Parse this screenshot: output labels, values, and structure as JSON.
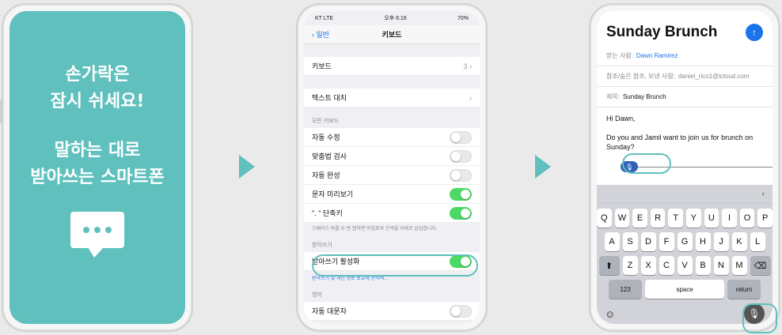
{
  "panel1": {
    "lines": [
      "손가락은",
      "잠시 쉬세요!",
      "말하는 대로",
      "받아쓰는 스마트폰"
    ]
  },
  "panel2": {
    "status": {
      "carrier": "KT LTE",
      "time": "오후 6:16",
      "battery": "70%"
    },
    "nav": {
      "back": "일반",
      "title": "키보드"
    },
    "keyboards": {
      "label": "키보드",
      "value": "3"
    },
    "text_replacement": "텍스트 대치",
    "all_keyboards_header": "모든 키보드",
    "toggles": [
      {
        "label": "자동 수정",
        "on": false
      },
      {
        "label": "맞춤법 검사",
        "on": false
      },
      {
        "label": "자동 완성",
        "on": false
      },
      {
        "label": "문자 미리보기",
        "on": true
      },
      {
        "label": "\". \" 단축키",
        "on": true
      }
    ],
    "shortcut_note": "스페이스 바를 두 번 탭하면 마침표와 간격을 차례로 삽입합니다.",
    "dictation_header": "받아쓰기",
    "dictation": {
      "label": "받아쓰기 활성화",
      "on": true
    },
    "dictation_link": "받아쓰기 및 개인 정보 보호에 관하여...",
    "english_header": "영어",
    "auto_caps": {
      "label": "자동 대문자",
      "on": false
    }
  },
  "panel3": {
    "title": "Sunday Brunch",
    "to_label": "받는 사람:",
    "to_value": "Dawn Ramirez",
    "cc_label": "참조/숨은 참조, 보낸 사람:",
    "cc_value": "daniel_rico1@icloud.com",
    "subject_label": "제목:",
    "subject_value": "Sunday Brunch",
    "body_greeting": "Hi Dawn,",
    "body_text": "Do you and Jamil want to join us for brunch on Sunday?",
    "keyboard": {
      "row1": [
        "Q",
        "W",
        "E",
        "R",
        "T",
        "Y",
        "U",
        "I",
        "O",
        "P"
      ],
      "row2": [
        "A",
        "S",
        "D",
        "F",
        "G",
        "H",
        "J",
        "K",
        "L"
      ],
      "row3": [
        "Z",
        "X",
        "C",
        "V",
        "B",
        "N",
        "M"
      ],
      "num_label": "123",
      "space_label": "space",
      "return_label": "return"
    }
  },
  "colors": {
    "accent": "#5fc0bd",
    "ios_blue": "#1a73e8",
    "toggle_on": "#4cd964"
  },
  "icons": [
    "chevron-left-icon",
    "chevron-right-icon",
    "send-arrow-icon",
    "mic-icon",
    "emoji-icon",
    "shift-icon",
    "backspace-icon"
  ]
}
